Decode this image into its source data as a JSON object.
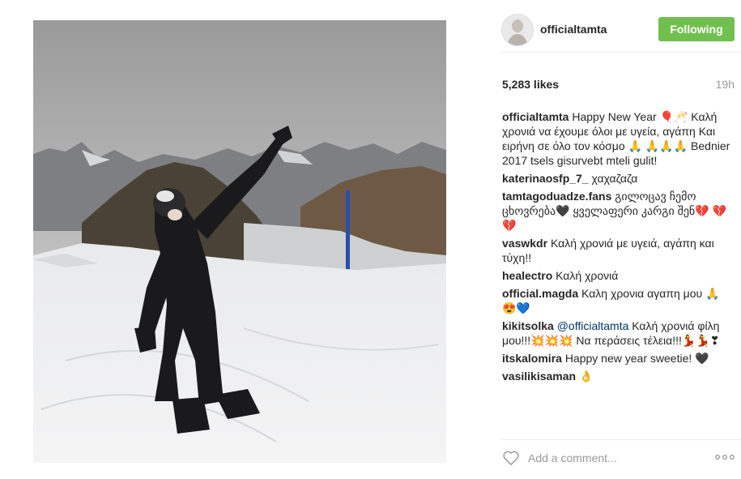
{
  "post": {
    "username": "officialtamta",
    "follow_label": "Following",
    "likes": "5,283 likes",
    "time": "19h",
    "comments": [
      {
        "user": "officialtamta",
        "text": "Happy New Year 🎈🥂 Καλή χρονιά να έχουμε όλοι με υγεία, αγάπη Και ειρήνη σε όλο τον κόσμο 🙏 🙏🙏🙏 Bednier 2017 tsels gisurvebt mteli gulit!"
      },
      {
        "user": "katerinaosfp_7_",
        "text": "χαχαζαζα"
      },
      {
        "user": "tamtagoduadze.fans",
        "text": "გილოცავ ჩემო ცხოვრება🖤 ყველაფერი კარგი შენ💔 💔💔"
      },
      {
        "user": "vaswkdr",
        "text": "Καλή χρονιά με υγειά, αγάπη και τύχη!!"
      },
      {
        "user": "healectro",
        "text": "Καλή χρονιά"
      },
      {
        "user": "official.magda",
        "text": "Καλη χρονια αγαπη μου 🙏😍💙"
      },
      {
        "user": "kikitsolka",
        "mention": "@officialtamta",
        "text": "Καλή χρονιά φίλη μου!!!💥💥💥 Να περάσεις τέλεια!!!💃💃❣"
      },
      {
        "user": "itskalomira",
        "text": "Happy new year sweetie! 🖤"
      },
      {
        "user": "vasilikisaman",
        "text": "👌"
      }
    ],
    "add_comment_placeholder": "Add a comment...",
    "icons": {
      "heart": "heart-icon",
      "more": "more-options-icon",
      "avatar": "avatar"
    },
    "colors": {
      "follow": "#70c050",
      "mention": "#003569",
      "muted": "#999999"
    }
  }
}
